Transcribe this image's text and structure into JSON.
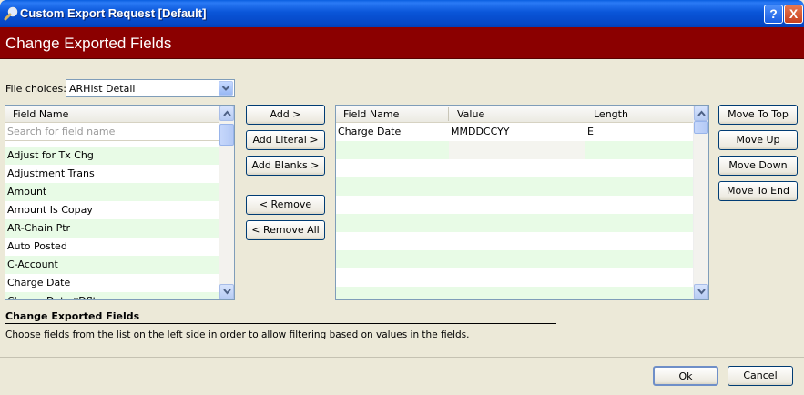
{
  "window": {
    "title": "Custom Export Request [Default]",
    "help_label": "?",
    "close_label": "X"
  },
  "header": {
    "title": "Change Exported Fields"
  },
  "file_choices": {
    "label": "File choices:",
    "value": "ARHist Detail"
  },
  "left_list": {
    "column": "Field Name",
    "search_placeholder": "Search for field name",
    "items": [
      "Adjust for Tx Chg",
      "Adjustment Trans",
      "Amount",
      "Amount Is Copay",
      "AR-Chain Ptr",
      "Auto Posted",
      "C-Account",
      "Charge Date",
      "Charge Date *Dflt"
    ]
  },
  "middle_buttons": {
    "add": "Add >",
    "add_literal": "Add Literal >",
    "add_blanks": "Add Blanks >",
    "remove": "< Remove",
    "remove_all": "< Remove All"
  },
  "grid": {
    "columns": [
      "Field Name",
      "Value",
      "Length"
    ],
    "rows": [
      {
        "field": "Charge Date",
        "value": "MMDDCCYY",
        "length": "E"
      }
    ]
  },
  "move_buttons": {
    "top": "Move To Top",
    "up": "Move Up",
    "down": "Move Down",
    "end": "Move To End"
  },
  "description": {
    "title": "Change Exported Fields",
    "text": "Choose fields from the list on the left side in order to allow filtering based on values in the fields."
  },
  "footer": {
    "ok": "Ok",
    "cancel": "Cancel"
  }
}
